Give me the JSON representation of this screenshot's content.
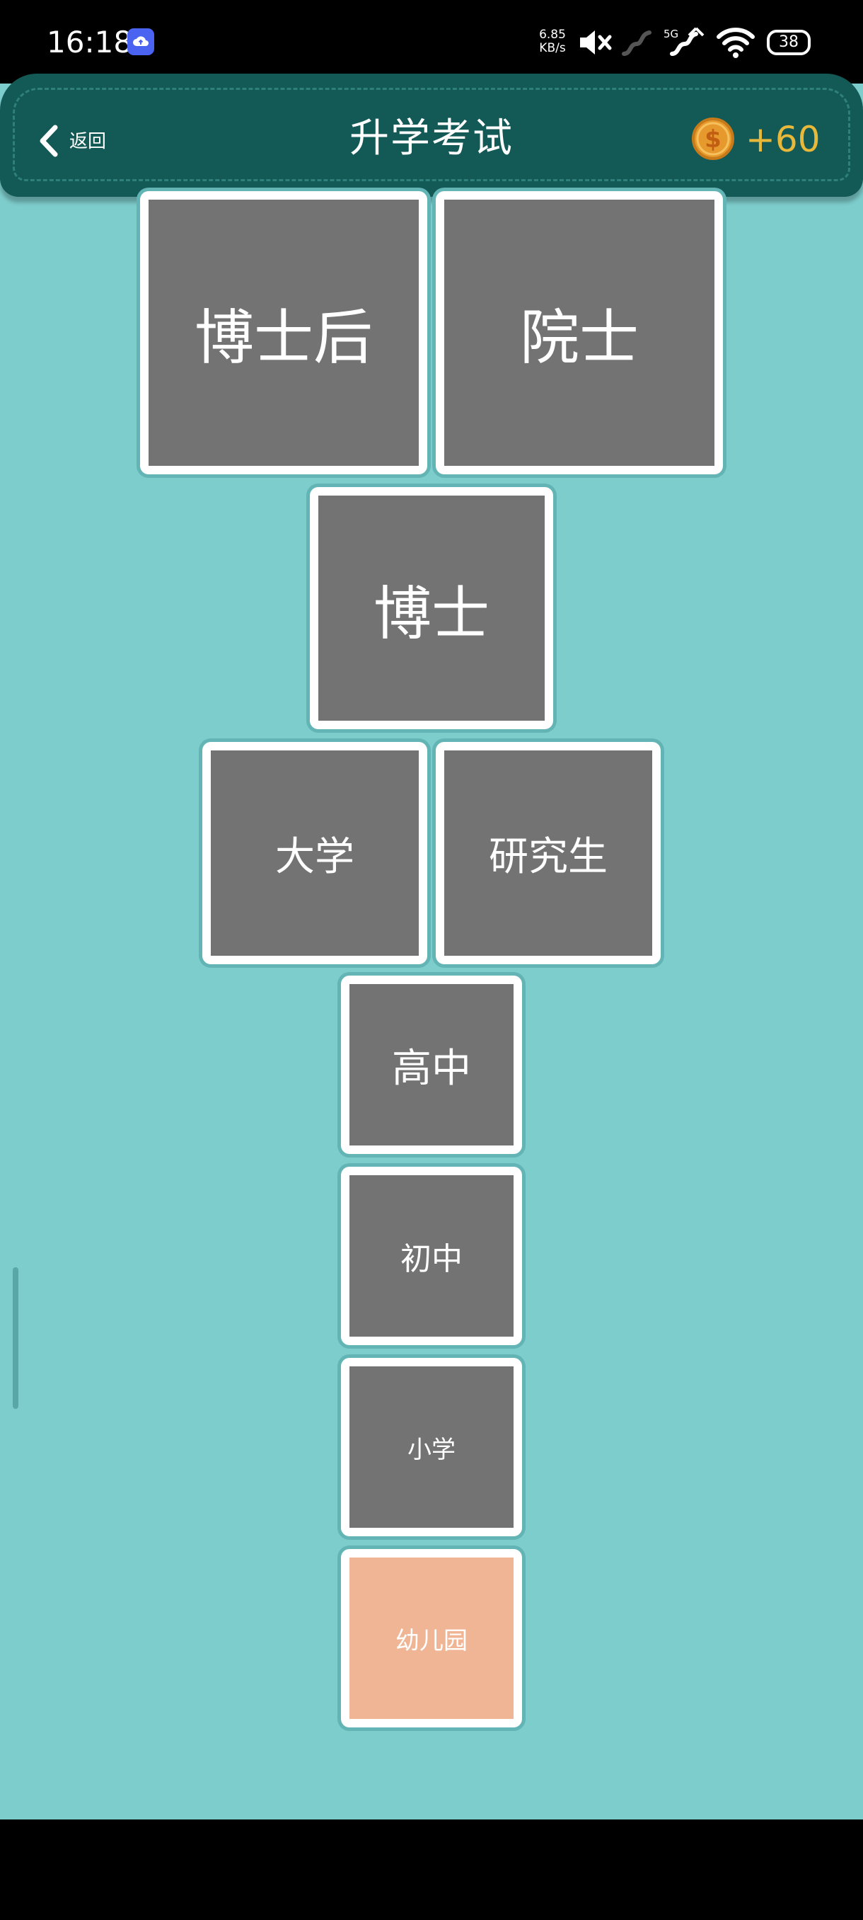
{
  "status_bar": {
    "time": "16:18",
    "network_speed_value": "6.85",
    "network_speed_unit": "KB/s",
    "network_type": "5G",
    "battery": "38",
    "icons": [
      "cloud-app-icon",
      "mute-icon",
      "signal-1-icon",
      "signal-2-icon",
      "wifi-icon",
      "battery-icon"
    ]
  },
  "header": {
    "back_label": "返回",
    "title": "升学考试",
    "coins": "+60",
    "colors": {
      "header_bg": "#135a56",
      "coin_text": "#e8b83a"
    }
  },
  "levels": [
    {
      "id": "postdoc",
      "label": "博士后",
      "state": "locked"
    },
    {
      "id": "academician",
      "label": "院士",
      "state": "locked"
    },
    {
      "id": "phd",
      "label": "博士",
      "state": "locked"
    },
    {
      "id": "university",
      "label": "大学",
      "state": "locked"
    },
    {
      "id": "graduate",
      "label": "研究生",
      "state": "locked"
    },
    {
      "id": "high-school",
      "label": "高中",
      "state": "locked"
    },
    {
      "id": "middle-school",
      "label": "初中",
      "state": "locked"
    },
    {
      "id": "primary-school",
      "label": "小学",
      "state": "locked"
    },
    {
      "id": "kindergarten",
      "label": "幼儿园",
      "state": "current"
    }
  ],
  "colors": {
    "background": "#7ecdcd",
    "tile_locked": "#737373",
    "tile_current": "#f0b594",
    "tile_border": "#ffffff"
  }
}
